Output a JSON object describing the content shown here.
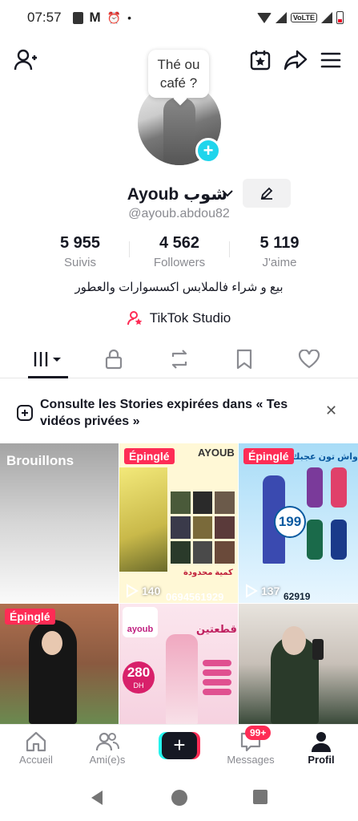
{
  "status_bar": {
    "time": "07:57",
    "network_label": "VoLTE"
  },
  "header": {
    "bubble_text_line1": "Thé ou",
    "bubble_text_line2": "café ?"
  },
  "profile": {
    "name": "Ayoub شوب",
    "handle": "@ayoub.abdou82",
    "bio": "بيع و شراء فالملابس اكسسوارات والعطور",
    "studio_label": "TikTok Studio"
  },
  "stats": [
    {
      "value": "5 955",
      "label": "Suivis"
    },
    {
      "value": "4 562",
      "label": "Followers"
    },
    {
      "value": "5 119",
      "label": "J'aime"
    }
  ],
  "stories_banner": {
    "text": "Consulte les Stories expirées dans « Tes vidéos privées »"
  },
  "grid": {
    "drafts_label": "Brouillons",
    "pinned_label": "Épinglé",
    "items": [
      {
        "pinned": true,
        "views": "140",
        "phone": "0694561929",
        "brand": "AYOUB",
        "promo": "كمية محدودة"
      },
      {
        "pinned": true,
        "views": "137",
        "price": "199",
        "phone": "62919",
        "headline": "واش تون عجبك؟"
      },
      {
        "pinned": true
      },
      {
        "brand": "ayoub",
        "price": "280",
        "currency": "DH",
        "headline": "قطعتين"
      },
      {}
    ]
  },
  "bottom_nav": {
    "items": [
      {
        "label": "Accueil"
      },
      {
        "label": "Ami(e)s"
      },
      {
        "label": "Messages"
      },
      {
        "label": "Profil"
      }
    ],
    "messages_badge": "99+"
  },
  "colors": {
    "accent": "#fe2c55",
    "cyan": "#25f4ee",
    "text": "#161823",
    "muted": "#8a8b91"
  }
}
